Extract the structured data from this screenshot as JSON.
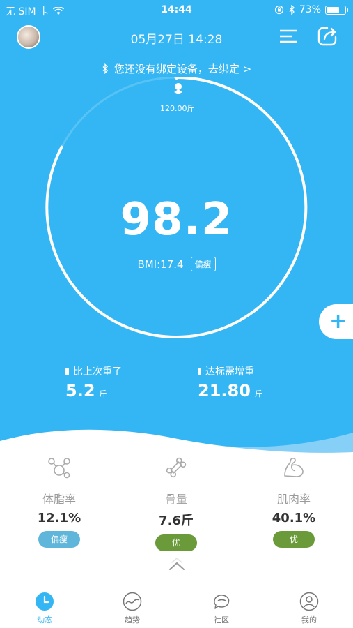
{
  "status_bar": {
    "carrier": "无 SIM 卡",
    "time": "14:44",
    "battery": "73%",
    "battery_level": 0.73
  },
  "header": {
    "datetime": "05月27日 14:28"
  },
  "bind_banner": {
    "text": "您还没有绑定设备，去绑定 >"
  },
  "gauge": {
    "target_label": "120.00斤",
    "weight": "98.2",
    "bmi_label": "BMI:17.4",
    "bmi_tag": "偏瘦"
  },
  "stats": {
    "change": {
      "label": "比上次重了",
      "value": "5.2",
      "unit": "斤"
    },
    "target": {
      "label": "达标需增重",
      "value": "21.80",
      "unit": "斤"
    }
  },
  "metrics": [
    {
      "name": "体脂率",
      "value": "12.1%",
      "badge": "偏瘦",
      "badge_color": "#5fb6da",
      "icon": "body-fat-icon"
    },
    {
      "name": "骨量",
      "value": "7.6斤",
      "badge": "优",
      "badge_color": "#6a9a3a",
      "icon": "bone-icon"
    },
    {
      "name": "肌肉率",
      "value": "40.1%",
      "badge": "优",
      "badge_color": "#6a9a3a",
      "icon": "muscle-icon"
    }
  ],
  "tabbar": {
    "items": [
      {
        "label": "动态",
        "icon": "clock-icon",
        "active": true
      },
      {
        "label": "趋势",
        "icon": "trend-icon",
        "active": false
      },
      {
        "label": "社区",
        "icon": "community-icon",
        "active": false
      },
      {
        "label": "我的",
        "icon": "profile-icon",
        "active": false
      }
    ]
  },
  "colors": {
    "hero": "#33b6f3",
    "accent": "#33b6f3",
    "badge_lean": "#5fb6da",
    "badge_good": "#6a9a3a"
  }
}
